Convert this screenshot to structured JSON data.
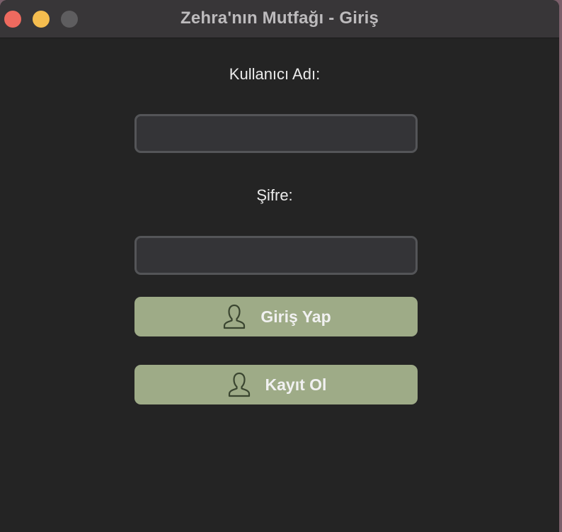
{
  "window": {
    "title": "Zehra'nın Mutfağı - Giriş"
  },
  "form": {
    "username_label": "Kullanıcı Adı:",
    "username_value": "",
    "password_label": "Şifre:",
    "password_value": ""
  },
  "buttons": {
    "login_label": "Giriş Yap",
    "login_icon": "user-icon",
    "register_label": "Kayıt Ol",
    "register_icon": "user-icon"
  },
  "colors": {
    "background": "#242424",
    "button": "#9eab87",
    "field": "#343437",
    "close": "#ee6a5f",
    "minimize": "#f5bd4f",
    "maximize": "#5e5d5f"
  }
}
